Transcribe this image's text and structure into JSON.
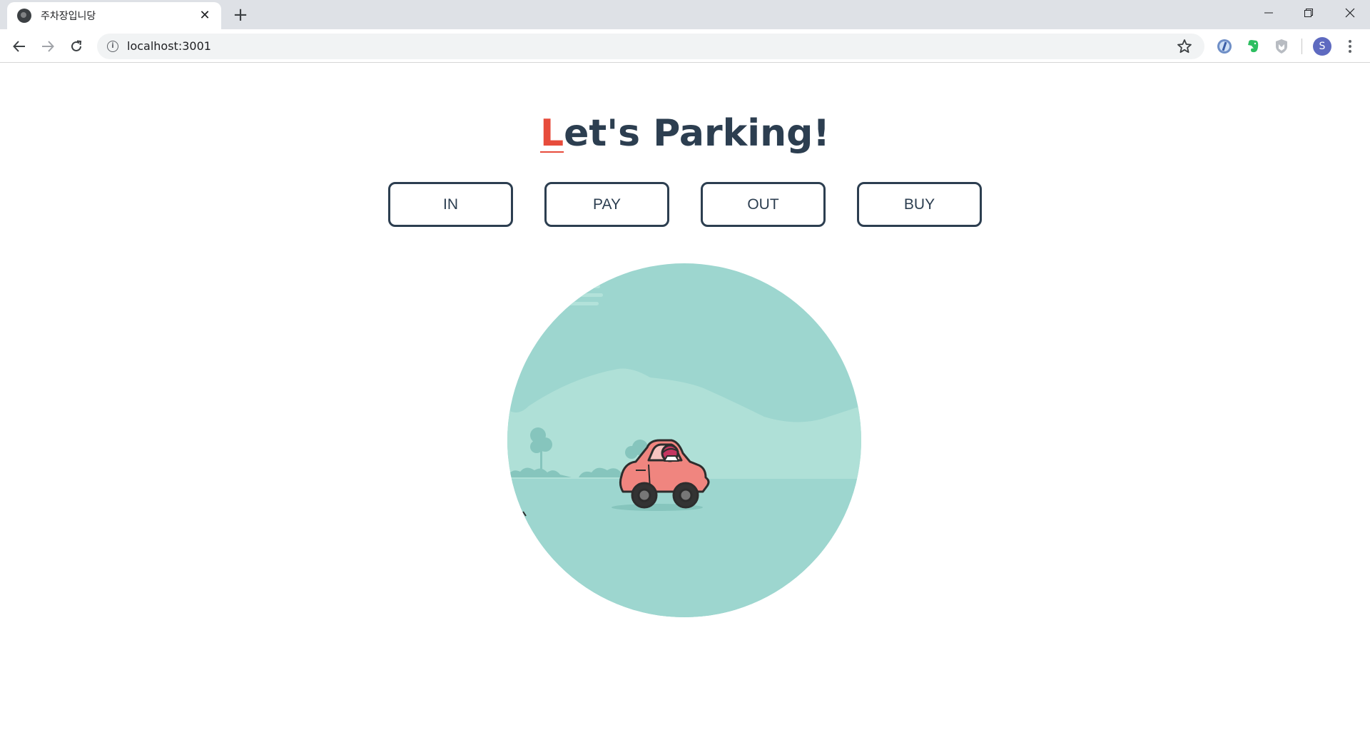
{
  "browser": {
    "tab_title": "주차장입니당",
    "close_glyph": "✕",
    "new_tab_glyph": "+",
    "url": "localhost:3001",
    "info_glyph": "i",
    "profile_initial": "S"
  },
  "page": {
    "title_first_letter": "L",
    "title_rest": "et's Parking!",
    "accent_color": "#e74c3c",
    "text_color": "#2c3e50"
  },
  "actions": [
    {
      "label": "IN"
    },
    {
      "label": "PAY"
    },
    {
      "label": "OUT"
    },
    {
      "label": "BUY"
    }
  ],
  "scene": {
    "sky_color": "#9dd6cf",
    "hill_color": "#afe0d7",
    "car_color": "#f0857f",
    "icon": "car-illustration"
  }
}
